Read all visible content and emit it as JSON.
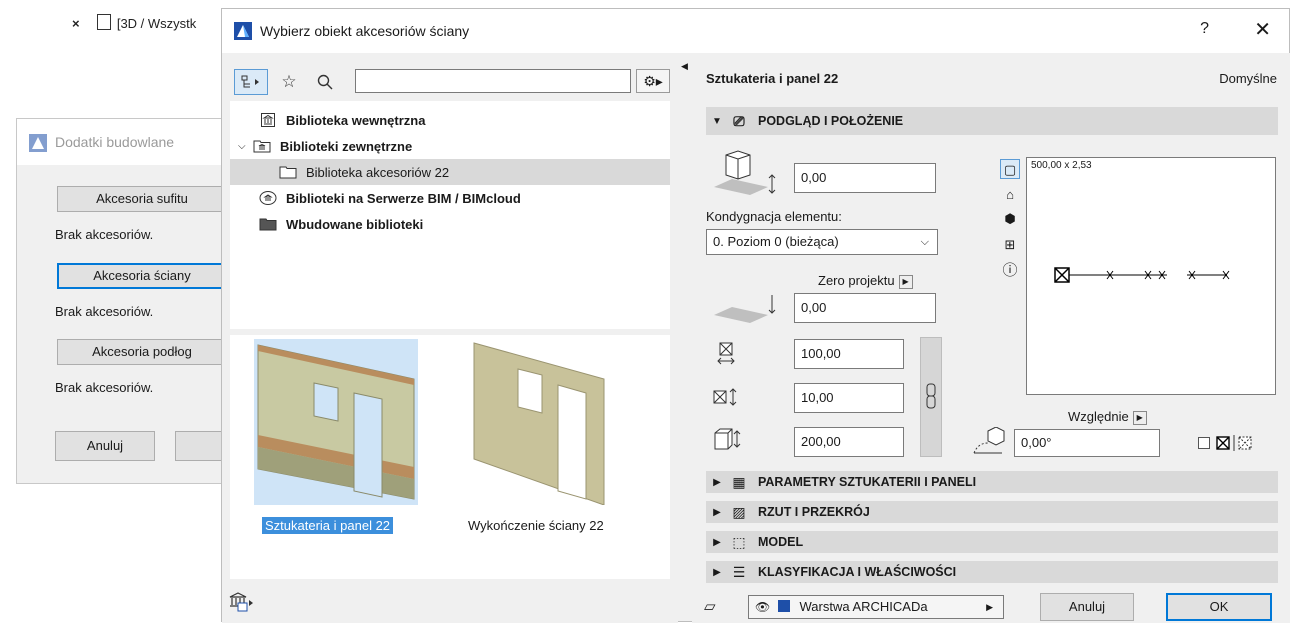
{
  "background": {
    "tab_close": "×",
    "tab_label": "[3D / Wszystk",
    "dialog_title": "Dodatki budowlane",
    "ceiling_button": "Akcesoria sufitu",
    "no_accessories_1": "Brak akcesoriów.",
    "wall_button": "Akcesoria ściany",
    "no_accessories_2": "Brak akcesoriów.",
    "floor_button": "Akcesoria podłog",
    "no_accessories_3": "Brak akcesoriów.",
    "cancel_button": "Anuluj"
  },
  "dialog": {
    "title": "Wybierz obiekt akcesoriów ściany",
    "help": "?",
    "close": "✕"
  },
  "search": {
    "placeholder": "",
    "value": ""
  },
  "tree": [
    {
      "label": "Biblioteka wewnętrzna",
      "bold": true
    },
    {
      "label": "Biblioteki zewnętrzne",
      "bold": true,
      "expanded": true
    },
    {
      "label": "Biblioteka akcesoriów 22",
      "bold": false,
      "selected": true
    },
    {
      "label": "Biblioteki na Serwerze BIM / BIMcloud",
      "bold": true
    },
    {
      "label": "Wbudowane biblioteki",
      "bold": true
    }
  ],
  "thumbnails": [
    {
      "label": "Sztukateria i panel 22",
      "selected": true
    },
    {
      "label": "Wykończenie ściany 22",
      "selected": false
    }
  ],
  "right": {
    "object_name": "Sztukateria i panel 22",
    "defaults_label": "Domyślne",
    "section_preview": "PODGLĄD I POŁOŻENIE",
    "height_offset": "0,00",
    "story_label": "Kondygnacja elementu:",
    "story_value": "0. Poziom 0 (bieżąca)",
    "zero_label": "Zero projektu",
    "zero_value": "0,00",
    "width_value": "100,00",
    "depth_value": "10,00",
    "height_value": "200,00",
    "preview_dims": "500,00 x 2,53",
    "relative_label": "Względnie",
    "angle_value": "0,00°",
    "sections": [
      "PARAMETRY SZTUKATERII I PANELI",
      "RZUT I PRZEKRÓJ",
      "MODEL",
      "KLASYFIKACJA I WŁAŚCIWOŚCI"
    ],
    "layer_value": "Warstwa ARCHICADa",
    "cancel_label": "Anuluj",
    "ok_label": "OK"
  },
  "colors": {
    "accent": "#0078d7",
    "selection": "#3c8fdc",
    "header": "#d9d9d9"
  }
}
